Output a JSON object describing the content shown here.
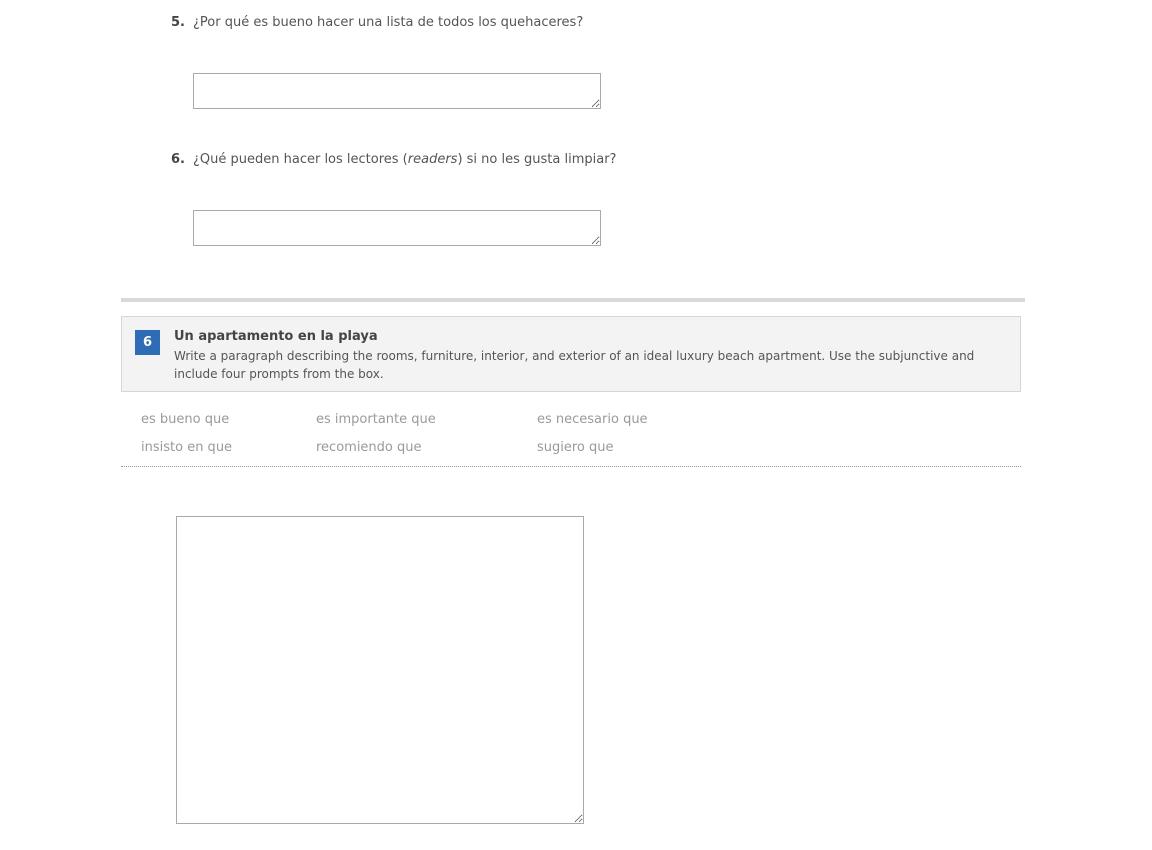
{
  "questions": [
    {
      "number": "5.",
      "text_before": "¿Por qué es bueno hacer una lista de todos los quehaceres?",
      "emphasis": "",
      "text_after": "",
      "answer_value": ""
    },
    {
      "number": "6.",
      "text_before": "¿Qué pueden hacer los lectores (",
      "emphasis": "readers",
      "text_after": ") si no les gusta limpiar?",
      "answer_value": ""
    }
  ],
  "activity": {
    "number": "6",
    "title": "Un apartamento en la playa",
    "instructions": "Write a paragraph describing the rooms, furniture, interior, and exterior of an ideal luxury beach apartment. Use the subjunctive and include four prompts from the box.",
    "badge_color": "#2e6cb5"
  },
  "prompt_box": {
    "row1": [
      "es bueno que",
      "es importante que",
      "es necesario que"
    ],
    "row2": [
      "insisto en que",
      "recomiendo que",
      "sugiero que"
    ]
  },
  "essay": {
    "value": ""
  }
}
